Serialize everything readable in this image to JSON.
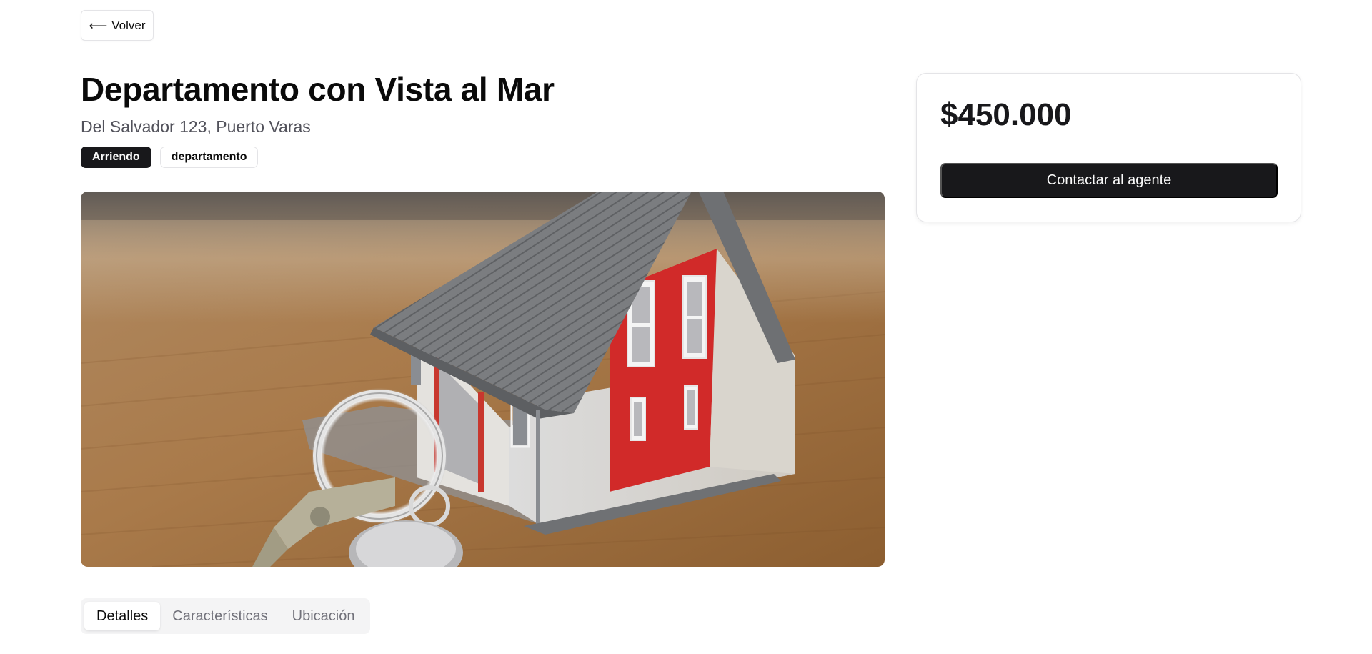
{
  "nav": {
    "back_label": "Volver",
    "back_icon": "arrow-left-icon"
  },
  "property": {
    "title": "Departamento con Vista al Mar",
    "address": "Del Salvador 123, Puerto Varas",
    "badges": [
      {
        "label": "Arriendo",
        "style": "dark"
      },
      {
        "label": "departamento",
        "style": "light"
      }
    ],
    "image_alt": "house model with keys"
  },
  "tabs": [
    {
      "label": "Detalles",
      "active": true
    },
    {
      "label": "Características",
      "active": false
    },
    {
      "label": "Ubicación",
      "active": false
    }
  ],
  "sidebar": {
    "price": "$450.000",
    "contact_label": "Contactar al agente"
  },
  "colors": {
    "primary": "#18181b",
    "muted_text": "#71717a",
    "border": "#e4e4e7"
  }
}
